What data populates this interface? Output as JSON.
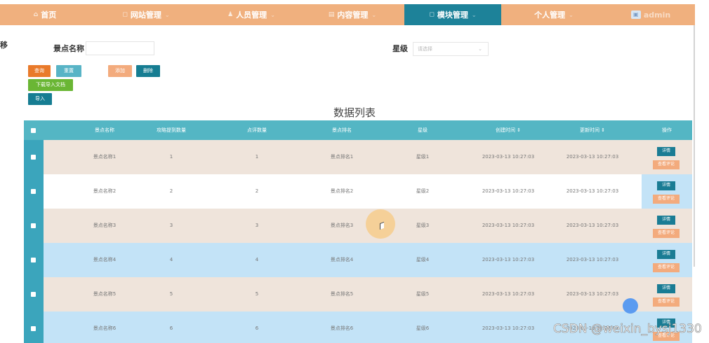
{
  "nav": {
    "items": [
      {
        "label": "首页",
        "icon": "home-icon"
      },
      {
        "label": "网站管理",
        "icon": "gear-icon"
      },
      {
        "label": "人员管理",
        "icon": "user-icon"
      },
      {
        "label": "内容管理",
        "icon": "doc-icon"
      },
      {
        "label": "模块管理",
        "icon": "module-icon"
      },
      {
        "label": "个人管理",
        "icon": "person-icon"
      }
    ],
    "admin_label": "admin"
  },
  "edge_label": "移",
  "search": {
    "name_label": "景点名称",
    "name_value": "",
    "star_label": "星级",
    "star_placeholder": "请选择"
  },
  "buttons": {
    "query": "查询",
    "reset": "重置",
    "add": "添加",
    "delete": "删除",
    "download": "下载导入文档",
    "import": "导入"
  },
  "table": {
    "title": "数据列表",
    "headers": [
      "景点名称",
      "攻略提到数量",
      "点评数量",
      "景点排名",
      "星级",
      "创建时间 ⇕",
      "更新时间 ⇕",
      "操作"
    ],
    "rows": [
      {
        "name": "景点名称1",
        "guide": "1",
        "reviews": "1",
        "rank": "景点排名1",
        "star": "星级1",
        "created": "2023-03-13 10:27:03",
        "updated": "2023-03-13 10:27:03"
      },
      {
        "name": "景点名称2",
        "guide": "2",
        "reviews": "2",
        "rank": "景点排名2",
        "star": "星级2",
        "created": "2023-03-13 10:27:03",
        "updated": "2023-03-13 10:27:03"
      },
      {
        "name": "景点名称3",
        "guide": "3",
        "reviews": "3",
        "rank": "景点排名3",
        "star": "星级3",
        "created": "2023-03-13 10:27:03",
        "updated": "2023-03-13 10:27:03"
      },
      {
        "name": "景点名称4",
        "guide": "4",
        "reviews": "4",
        "rank": "景点排名4",
        "star": "星级4",
        "created": "2023-03-13 10:27:03",
        "updated": "2023-03-13 10:27:03"
      },
      {
        "name": "景点名称5",
        "guide": "5",
        "reviews": "5",
        "rank": "景点排名5",
        "star": "星级5",
        "created": "2023-03-13 10:27:03",
        "updated": "2023-03-13 10:27:03"
      },
      {
        "name": "景点名称6",
        "guide": "6",
        "reviews": "6",
        "rank": "景点排名6",
        "star": "星级6",
        "created": "2023-03-13 10:27:03",
        "updated": "2023-03-13 10:27:03"
      }
    ],
    "action_detail": "详情",
    "action_review": "查看评论"
  },
  "watermark": "CSDN @weixin_bysj1330",
  "colors": {
    "nav_bg": "#f0b07e",
    "nav_active": "#1d8299",
    "header_bg": "#54b6c4",
    "row_beige": "#efe4db",
    "row_white": "#ffffff",
    "row_blue": "#c3e3f7",
    "btn_orange": "#e97a2a",
    "btn_teal": "#58b4c6",
    "btn_peach": "#f3ab7d",
    "btn_dark_teal": "#167d92",
    "btn_green": "#6ab634",
    "btn_blue": "#167d92"
  }
}
